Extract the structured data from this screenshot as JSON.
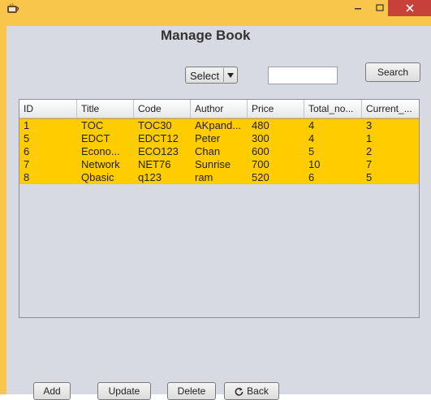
{
  "page_title": "Manage Book",
  "filter": {
    "select_label": "Select"
  },
  "search": {
    "value": "",
    "button_label": "Search"
  },
  "table": {
    "columns": [
      "ID",
      "Title",
      "Code",
      "Author",
      "Price",
      "Total_no...",
      "Current_..."
    ],
    "rows": [
      [
        "1",
        "TOC",
        "TOC30",
        "AKpand...",
        "480",
        "4",
        "3"
      ],
      [
        "5",
        "EDCT",
        "EDCT12",
        "Peter",
        "300",
        "4",
        "1"
      ],
      [
        "6",
        "Econo...",
        "ECO123",
        "Chan",
        "600",
        "5",
        "2"
      ],
      [
        "7",
        "Network",
        "NET76",
        "Sunrise",
        "700",
        "10",
        "7"
      ],
      [
        "8",
        "Qbasic",
        "q123",
        "ram",
        "520",
        "6",
        "5"
      ]
    ]
  },
  "buttons": {
    "add": "Add",
    "update": "Update",
    "delete": "Delete",
    "back": "Back"
  },
  "colors": {
    "selection": "#ffcc00",
    "title_bar": "#f8c64a",
    "panel": "#d8dae3"
  }
}
